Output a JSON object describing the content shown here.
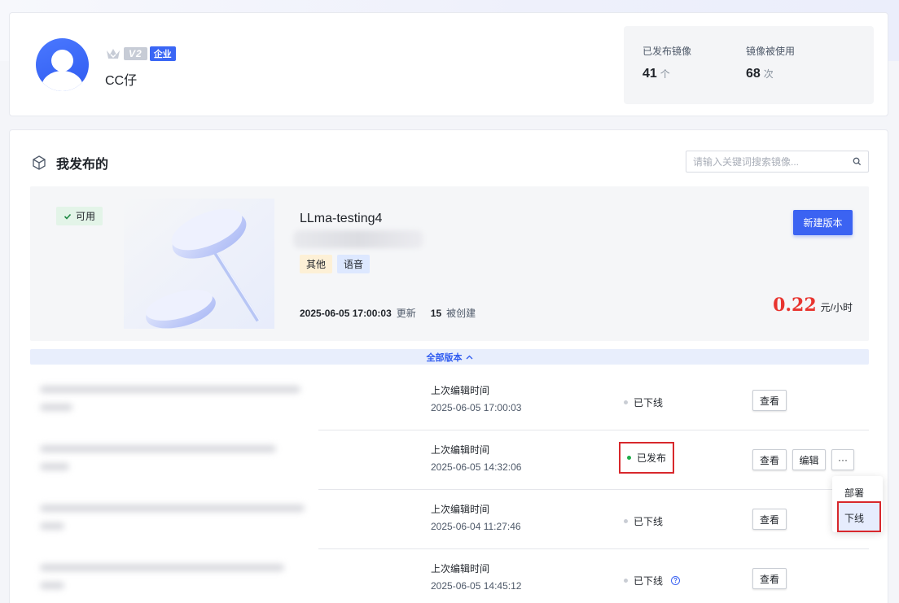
{
  "profile": {
    "username": "CC仔",
    "level_badge": "V2",
    "type_badge": "企业",
    "stats": [
      {
        "label": "已发布镜像",
        "value": "41",
        "unit": "个"
      },
      {
        "label": "镜像被使用",
        "value": "68",
        "unit": "次"
      }
    ]
  },
  "section": {
    "title": "我发布的",
    "search_placeholder": "请输入关键词搜索镜像..."
  },
  "hero": {
    "status": "可用",
    "name": "LLma-testing4",
    "tags": [
      "其他",
      "语音"
    ],
    "updated_at": "2025-06-05 17:00:03",
    "updated_label": "更新",
    "created_count": "15",
    "created_label": "被创建",
    "new_version_label": "新建版本",
    "price": "0.22",
    "price_unit": "元/小时"
  },
  "all_versions_label": "全部版本",
  "versions": [
    {
      "time_label": "上次编辑时间",
      "time": "2025-06-05 17:00:03",
      "status": "已下线",
      "view": "查看"
    },
    {
      "time_label": "上次编辑时间",
      "time": "2025-06-05 14:32:06",
      "status": "已发布",
      "view": "查看",
      "edit": "编辑",
      "more": "···"
    },
    {
      "time_label": "上次编辑时间",
      "time": "2025-06-04 11:27:46",
      "status": "已下线",
      "view": "查看"
    },
    {
      "time_label": "上次编辑时间",
      "time": "2025-06-05 14:45:12",
      "status": "已下线",
      "view": "查看",
      "help": "?"
    }
  ],
  "menu": {
    "deploy": "部署",
    "offline": "下线"
  }
}
